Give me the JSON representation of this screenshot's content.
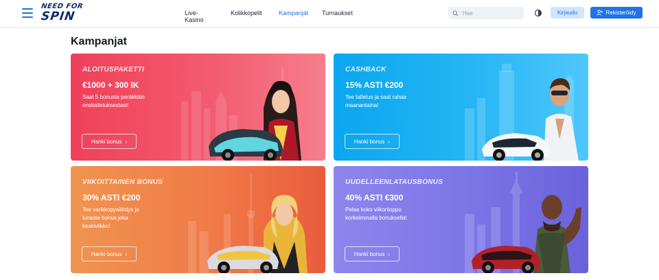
{
  "header": {
    "logo_line1": "NEED FOR",
    "logo_line2": "SPIN",
    "nav": [
      {
        "label": "Live-Kasino"
      },
      {
        "label": "Kolikkopelit"
      },
      {
        "label": "Kampanjat",
        "active": true
      },
      {
        "label": "Turnaukset"
      }
    ],
    "search_placeholder": "Hae",
    "login_label": "Kirjaudu",
    "register_label": "Rekisteröidy",
    "accent_color": "#1f73e6"
  },
  "page": {
    "title": "Kampanjat"
  },
  "promotions": [
    {
      "tag": "ALOITUSPAKETTI",
      "headline": "€1000 + 300 IK",
      "description": "Saat 5 bonusta peräkkäin ensitalletuksestasi!",
      "cta": "Hanki bonus",
      "color": "#f0405a"
    },
    {
      "tag": "CASHBACK",
      "headline": "15% ASTI €200",
      "description": "Tee talletus ja saat rahaa maanantaina!",
      "cta": "Hanki bonus",
      "color": "#0aa6ee"
    },
    {
      "tag": "VIIKOITTAINEN BONUS",
      "headline": "30% ASTI €200",
      "description": "Tee varikkopysähdys ja lunasta bonus joka keskiviikko!",
      "cta": "Hanki bonus",
      "color": "#f07a48"
    },
    {
      "tag": "UUDELLEENLATAUSBONUS",
      "headline": "40% ASTI €300",
      "description": "Pelaa koko viikonloppu korkeimmalla bonuksella!",
      "cta": "Hanki bonus",
      "color": "#7b74e6"
    }
  ],
  "icons": {
    "menu": "hamburger-icon",
    "search": "search-icon",
    "theme": "half-circle-theme-icon",
    "register": "user-plus-icon",
    "cta": "chevron-right-icon"
  }
}
